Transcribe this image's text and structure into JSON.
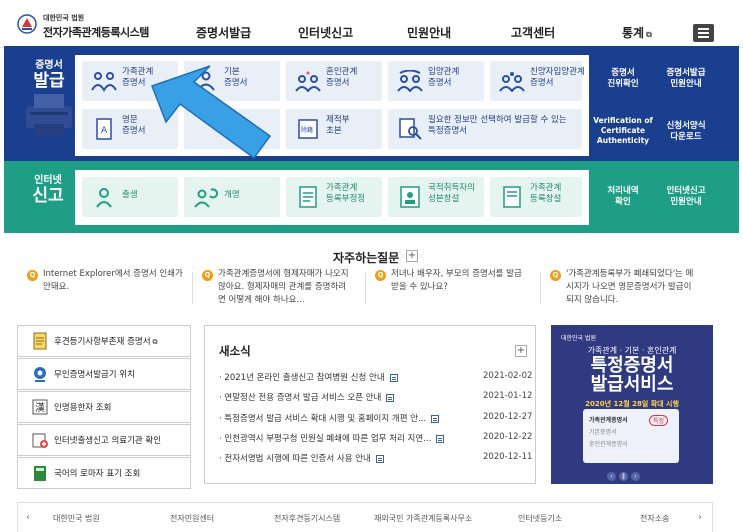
{
  "header": {
    "org": "대한민국 법원",
    "title": "전자가족관계등록시스템",
    "nav": [
      {
        "label": "증명서발급"
      },
      {
        "label": "인터넷신고"
      },
      {
        "label": "민원안내"
      },
      {
        "label": "고객센터"
      },
      {
        "label": "통계"
      }
    ]
  },
  "certificates": {
    "title_small": "증명서",
    "title_big": "발급",
    "cards": [
      {
        "line1": "가족관계",
        "line2": "증명서"
      },
      {
        "line1": "기본",
        "line2": "증명서"
      },
      {
        "line1": "혼인관계",
        "line2": "증명서"
      },
      {
        "line1": "입양관계",
        "line2": "증명서"
      },
      {
        "line1": "친양자입양관계",
        "line2": "증명서"
      },
      {
        "line1": "영문",
        "line2": "증명서"
      },
      {
        "line1": "",
        "line2": ""
      },
      {
        "line1": "제적부",
        "line2": "초본"
      },
      {
        "line1": "필요한 정보만 선택하여 발급할 수 있는",
        "line2": "특정증명서"
      }
    ],
    "side": [
      {
        "line1": "증명서",
        "line2": "진위확인"
      },
      {
        "line1": "증명서발급",
        "line2": "민원안내"
      },
      {
        "line1": "Verification of",
        "line2": "Certificate",
        "line3": "Authenticity"
      },
      {
        "line1": "신청서양식",
        "line2": "다운로드"
      }
    ]
  },
  "report": {
    "title_small": "인터넷",
    "title_big": "신고",
    "cards": [
      {
        "line1": "출생",
        "line2": ""
      },
      {
        "line1": "개명",
        "line2": ""
      },
      {
        "line1": "가족관계",
        "line2": "등록부정정"
      },
      {
        "line1": "국적취득자의",
        "line2": "성본창설"
      },
      {
        "line1": "가족관계",
        "line2": "등록창설"
      }
    ],
    "side": [
      {
        "line1": "처리내역",
        "line2": "확인"
      },
      {
        "line1": "인터넷신고",
        "line2": "민원안내"
      }
    ]
  },
  "faq": {
    "title": "자주하는질문",
    "items": [
      {
        "l1": "Internet Explorer에서 증명서 인쇄가",
        "l2": "안돼요."
      },
      {
        "l1": "가족관계증명서에 형제자매가 나오지",
        "l2": "않아요. 형제자매의 관계를 증명하려",
        "l3": "면 어떻게 해야 하나요..."
      },
      {
        "l1": "저녀나 배우자, 부모의 증명서를 발급",
        "l2": "받을 수 있나요?"
      },
      {
        "l1": "'가족관계등록부가 폐쇄되었다'는 메",
        "l2": "시지가 나오면 영문증명서가 발급이",
        "l3": "되지 않습니다."
      }
    ]
  },
  "links": [
    {
      "label": "후견등기사항부존재 증명서",
      "icon": "document-icon"
    },
    {
      "label": "무인증명서발급기 위치",
      "icon": "location-icon"
    },
    {
      "label": "인명용한자 조회",
      "icon": "hanja-icon"
    },
    {
      "label": "인터넷출생신고 의료기관 확인",
      "icon": "hospital-icon"
    },
    {
      "label": "국어의 로마자 표기 조회",
      "icon": "book-icon"
    }
  ],
  "news": {
    "title": "새소식",
    "items": [
      {
        "text": "2021년 온라인 출생신고 참여병원 신청 안내",
        "date": "2021-02-02"
      },
      {
        "text": "연말정산 전용 증명서 발급 서비스 오픈 안내",
        "date": "2021-01-12"
      },
      {
        "text": "특정증명서 발급 서비스 확대 시행 및 홈페이지 개편 안...",
        "date": "2020-12-27"
      },
      {
        "text": "인천광역시 부평구청 민원실 폐쇄에 따른 업무 처리 지연...",
        "date": "2020-12-22"
      },
      {
        "text": "전자서명법 시행에 따른 인증서 사용 안내",
        "date": "2020-12-11"
      }
    ]
  },
  "banner": {
    "logo": "대한민국 법원",
    "line1": "가족관계 · 기본 · 혼인관계",
    "line2a": "특정증명서",
    "line2b": "발급서비스",
    "line3": "2020년 12월 28일 확대 시행",
    "panel": [
      "가족관계증명서",
      "기본증명서",
      "혼인관계증명서",
      "특정"
    ]
  },
  "footer": [
    "대한민국 법원",
    "전자민원센터",
    "전자후견등기시스템",
    "재외국민 가족관계등록사무소",
    "인터넷등기소",
    "전자소송"
  ]
}
